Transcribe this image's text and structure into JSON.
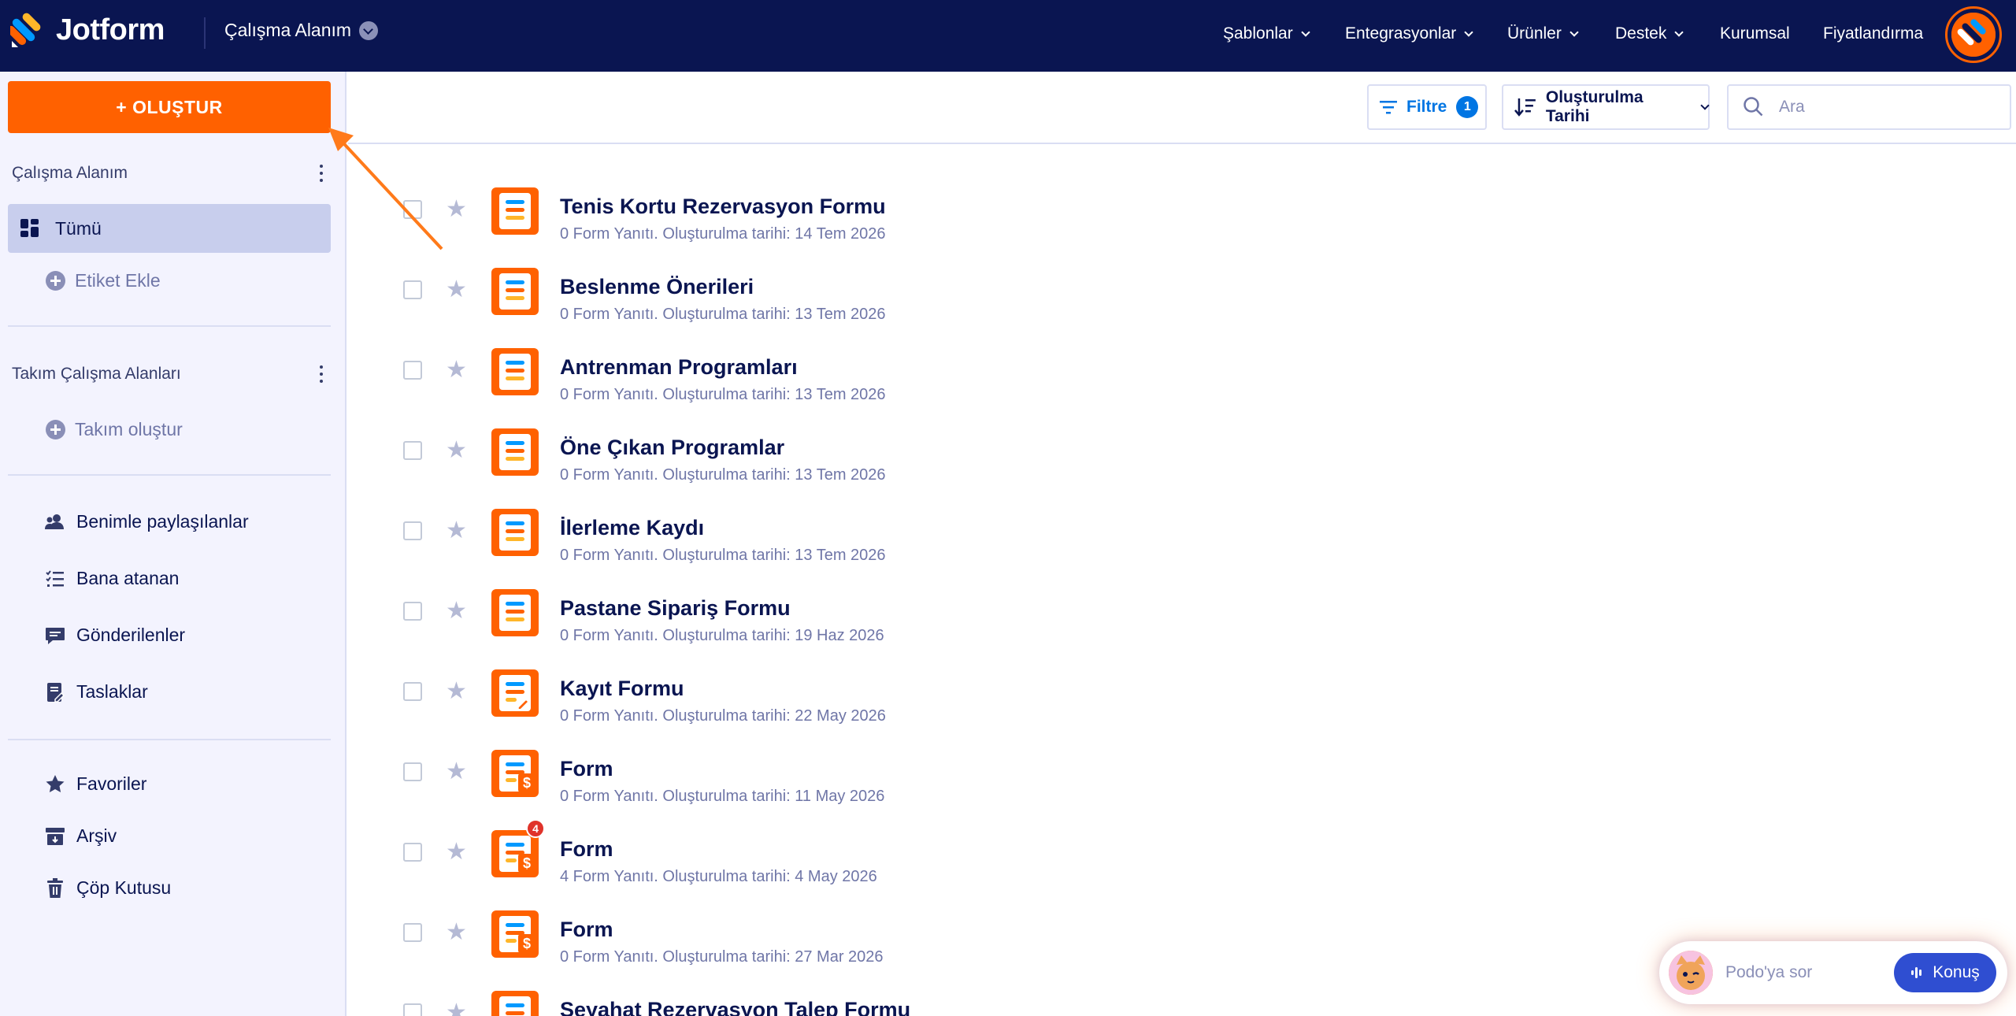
{
  "app": {
    "name": "Jotform"
  },
  "header": {
    "workspace": "Çalışma Alanım",
    "nav": [
      {
        "label": "Şablonlar",
        "dropdown": true
      },
      {
        "label": "Entegrasyonlar",
        "dropdown": true
      },
      {
        "label": "Ürünler",
        "dropdown": true
      },
      {
        "label": "Destek",
        "dropdown": true
      },
      {
        "label": "Kurumsal",
        "dropdown": false
      },
      {
        "label": "Fiyatlandırma",
        "dropdown": false
      }
    ]
  },
  "sidebar": {
    "create_label": "+ OLUŞTUR",
    "workspace_title": "Çalışma Alanım",
    "all_label": "Tümü",
    "add_tag_label": "Etiket Ekle",
    "team_title": "Takım Çalışma Alanları",
    "create_team_label": "Takım oluştur",
    "links": [
      {
        "label": "Benimle paylaşılanlar",
        "icon": "users-icon"
      },
      {
        "label": "Bana atanan",
        "icon": "checklist-icon"
      },
      {
        "label": "Gönderilenler",
        "icon": "message-icon"
      },
      {
        "label": "Taslaklar",
        "icon": "draft-icon"
      },
      {
        "label": "Favoriler",
        "icon": "star-icon"
      },
      {
        "label": "Arşiv",
        "icon": "archive-icon"
      },
      {
        "label": "Çöp Kutusu",
        "icon": "trash-icon"
      }
    ]
  },
  "toolbar": {
    "filter_label": "Filtre",
    "filter_count": "1",
    "sort_label": "Oluşturulma Tarihi",
    "search_placeholder": "Ara"
  },
  "forms": [
    {
      "title": "Tenis Kortu Rezervasyon Formu",
      "subtitle": "0 Form Yanıtı. Oluşturulma tarihi: 14 Tem 2026",
      "icon": "form-icon"
    },
    {
      "title": "Beslenme Önerileri",
      "subtitle": "0 Form Yanıtı. Oluşturulma tarihi: 13 Tem 2026",
      "icon": "form-icon"
    },
    {
      "title": "Antrenman Programları",
      "subtitle": "0 Form Yanıtı. Oluşturulma tarihi: 13 Tem 2026",
      "icon": "form-icon"
    },
    {
      "title": "Öne Çıkan Programlar",
      "subtitle": "0 Form Yanıtı. Oluşturulma tarihi: 13 Tem 2026",
      "icon": "form-icon"
    },
    {
      "title": "İlerleme Kaydı",
      "subtitle": "0 Form Yanıtı. Oluşturulma tarihi: 13 Tem 2026",
      "icon": "form-icon"
    },
    {
      "title": "Pastane Sipariş Formu",
      "subtitle": "0 Form Yanıtı. Oluşturulma tarihi: 19 Haz 2026",
      "icon": "form-icon"
    },
    {
      "title": "Kayıt Formu",
      "subtitle": "0 Form Yanıtı. Oluşturulma tarihi: 22 May 2026",
      "icon": "form-sign-icon"
    },
    {
      "title": "Form",
      "subtitle": "0 Form Yanıtı. Oluşturulma tarihi: 11 May 2026",
      "icon": "form-payment-icon"
    },
    {
      "title": "Form",
      "subtitle": "4 Form Yanıtı. Oluşturulma tarihi: 4 May 2026",
      "icon": "form-payment-icon",
      "badge": "4"
    },
    {
      "title": "Form",
      "subtitle": "0 Form Yanıtı. Oluşturulma tarihi: 27 Mar 2026",
      "icon": "form-payment-icon"
    },
    {
      "title": "Seyahat Rezervasyon Talep Formu",
      "subtitle": "",
      "icon": "form-icon"
    }
  ],
  "podo": {
    "placeholder": "Podo'ya sor",
    "talk_label": "Konuş"
  },
  "colors": {
    "nav_bg": "#0a1551",
    "accent": "#ff6100",
    "active_item": "#c8ceed",
    "link_blue": "#0075e3",
    "podo_button": "#2f4ed1"
  }
}
